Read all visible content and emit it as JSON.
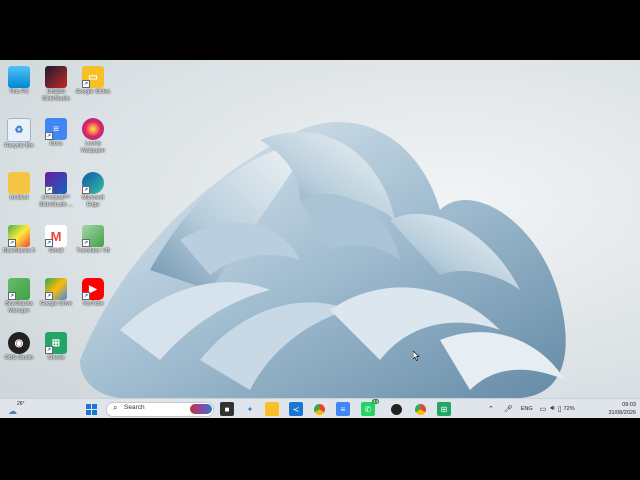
{
  "desktop": {
    "icons": [
      {
        "id": "this-pc",
        "label": "This PC"
      },
      {
        "id": "dbd",
        "label": "DB&B3 SlideStudio"
      },
      {
        "id": "google-slides",
        "label": "Google Slides"
      },
      {
        "id": "recycle-bin",
        "label": "Recycle Bin"
      },
      {
        "id": "docs",
        "label": "Docs"
      },
      {
        "id": "lovely-wallpaper",
        "label": "Lovely Wallpaper"
      },
      {
        "id": "untitled-folder",
        "label": "Untitled"
      },
      {
        "id": "shortcut-app",
        "label": "eFootball™ SlideStudio ..."
      },
      {
        "id": "microsoft-edge",
        "label": "Microsoft Edge"
      },
      {
        "id": "bluestacks",
        "label": "BlueStacks 5"
      },
      {
        "id": "gmail",
        "label": "Gmail"
      },
      {
        "id": "sheets-app",
        "label": "Translator VB"
      },
      {
        "id": "bluestacks-manager",
        "label": "BlueStacks Manager"
      },
      {
        "id": "google-drive",
        "label": "Google Drive"
      },
      {
        "id": "youtube",
        "label": "YouTube"
      },
      {
        "id": "obs-studio",
        "label": "OBS Studio"
      },
      {
        "id": "sheets",
        "label": "Sheets"
      }
    ]
  },
  "taskbar": {
    "weather": {
      "temp": "26°"
    },
    "search": {
      "placeholder": "Search"
    },
    "whatsapp_badge": "44",
    "tray": {
      "language": "ENG",
      "battery": "72%",
      "time": "09:03",
      "date": "31/08/2026"
    }
  },
  "colors": {
    "taskbar": "#dfe5ea",
    "wallpaper_light": "#eef2f4",
    "petal": "#8fb1c7"
  }
}
